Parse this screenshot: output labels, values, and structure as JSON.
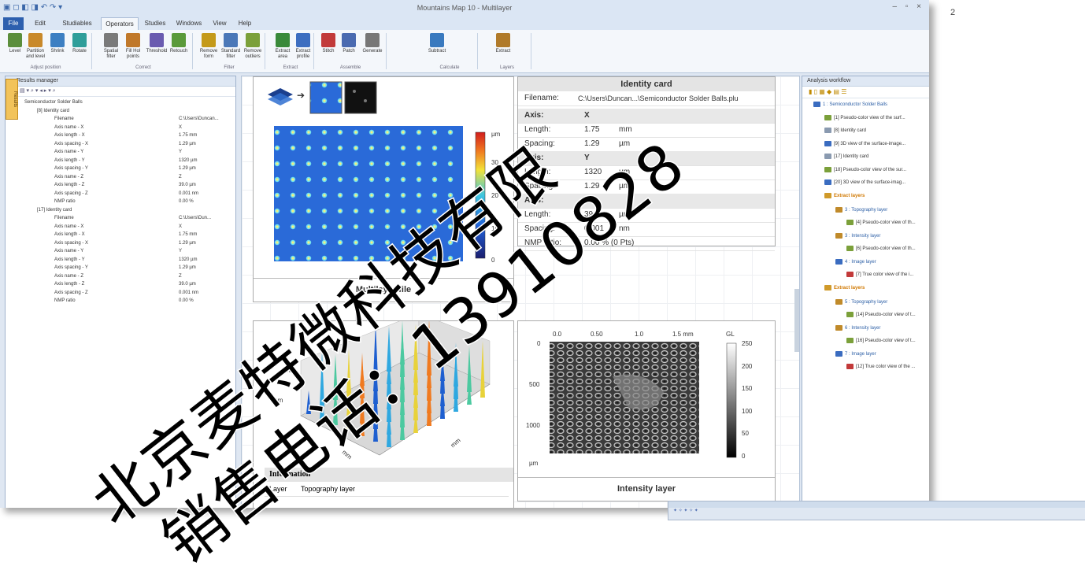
{
  "window": {
    "title": "Mountains Map 10 - Multilayer",
    "controls": "– ▫ ×",
    "tabs": [
      "File",
      "Edit",
      "Studiables",
      "Operators",
      "Studies",
      "Windows",
      "View",
      "Help"
    ],
    "active_tab": "Operators"
  },
  "ribbon": {
    "buttons": [
      {
        "label": "Level",
        "color": "#5b8e3c"
      },
      {
        "label": "Partition and level",
        "color": "#c9892a"
      },
      {
        "label": "Shrink",
        "color": "#3d7fc2"
      },
      {
        "label": "Rotate",
        "color": "#2f9e9a"
      },
      {
        "label": "Spatial filter",
        "color": "#7a7a7a"
      },
      {
        "label": "Fill Hol points",
        "color": "#c0782a"
      },
      {
        "label": "Threshold",
        "color": "#6a5bb0"
      },
      {
        "label": "Retouch",
        "color": "#5a9a3a"
      },
      {
        "label": "Remove form",
        "color": "#c49a1a"
      },
      {
        "label": "Standard filter",
        "color": "#4b78b8"
      },
      {
        "label": "Remove outliers",
        "color": "#7ba03a"
      },
      {
        "label": "Extract area",
        "color": "#3a8a3a"
      },
      {
        "label": "Extract profile",
        "color": "#3d6ec0"
      },
      {
        "label": "Stitch",
        "color": "#c23a3a"
      },
      {
        "label": "Patch",
        "color": "#4a6ab0"
      },
      {
        "label": "Generate",
        "color": "#777777"
      },
      {
        "label": "Subtract",
        "color": "#3a7abf"
      },
      {
        "label": "Extract",
        "color": "#b07a2a"
      }
    ],
    "groups": [
      "Adjust position",
      "Correct",
      "Filter",
      "Extract",
      "Assemble",
      "Calculate",
      "Layers"
    ]
  },
  "results_manager": {
    "title": "Results manager",
    "side_tab": "Results",
    "root": "Semiconductor Solder Balls",
    "cards": [
      {
        "label": "[8] Identity card",
        "rows": [
          {
            "k": "Filename",
            "v": "C:\\Users\\Duncan..."
          },
          {
            "k": "Axis name - X",
            "v": "X"
          },
          {
            "k": "Axis length - X",
            "v": "1.75 mm"
          },
          {
            "k": "Axis spacing - X",
            "v": "1.29 µm"
          },
          {
            "k": "Axis name - Y",
            "v": "Y"
          },
          {
            "k": "Axis length - Y",
            "v": "1320 µm"
          },
          {
            "k": "Axis spacing - Y",
            "v": "1.29 µm"
          },
          {
            "k": "Axis name - Z",
            "v": "Z"
          },
          {
            "k": "Axis length - Z",
            "v": "39.0 µm"
          },
          {
            "k": "Axis spacing - Z",
            "v": "0.001 nm"
          },
          {
            "k": "NMP ratio",
            "v": "0.00 %"
          }
        ]
      },
      {
        "label": "[17] Identity card",
        "rows": [
          {
            "k": "Filename",
            "v": "C:\\Users\\Dun..."
          },
          {
            "k": "Axis name - X",
            "v": "X"
          },
          {
            "k": "Axis length - X",
            "v": "1.75 mm"
          },
          {
            "k": "Axis spacing - X",
            "v": "1.29 µm"
          },
          {
            "k": "Axis name - Y",
            "v": "Y"
          },
          {
            "k": "Axis length - Y",
            "v": "1320 µm"
          },
          {
            "k": "Axis spacing - Y",
            "v": "1.29 µm"
          },
          {
            "k": "Axis name - Z",
            "v": "Z"
          },
          {
            "k": "Axis length - Z",
            "v": "39.0 µm"
          },
          {
            "k": "Axis spacing - Z",
            "v": "0.001 nm"
          },
          {
            "k": "NMP ratio",
            "v": "0.00 %"
          }
        ]
      }
    ]
  },
  "multilayer": {
    "caption": "Multilayer file",
    "unit": "µm",
    "scale_ticks": [
      "30",
      "20",
      "10",
      "0"
    ]
  },
  "identity_card": {
    "title": "Identity card",
    "filename_label": "Filename:",
    "filename_value": "C:\\Users\\Duncan...\\Semiconductor Solder Balls.plu",
    "rows": [
      {
        "c1": "Axis:",
        "c2": "X",
        "c3": "",
        "hdr": true
      },
      {
        "c1": "Length:",
        "c2": "1.75",
        "c3": "mm",
        "hdr": false
      },
      {
        "c1": "Spacing:",
        "c2": "1.29",
        "c3": "µm",
        "hdr": false
      },
      {
        "c1": "Axis:",
        "c2": "Y",
        "c3": "",
        "hdr": true
      },
      {
        "c1": "Length:",
        "c2": "1320",
        "c3": "µm",
        "hdr": false
      },
      {
        "c1": "Spacing:",
        "c2": "1.29",
        "c3": "µm",
        "hdr": false
      },
      {
        "c1": "Axis:",
        "c2": "Z",
        "c3": "",
        "hdr": true
      },
      {
        "c1": "Length:",
        "c2": "39.0",
        "c3": "µm",
        "hdr": false
      },
      {
        "c1": "Spacing:",
        "c2": "0.001",
        "c3": "nm",
        "hdr": false
      },
      {
        "c1": "NMP ratio:",
        "c2": "0.00 % (0 Pts)",
        "c3": "",
        "hdr": false
      }
    ]
  },
  "view3d": {
    "z_tick": "30",
    "z_unit": "µm",
    "x_unit": "mm",
    "y_unit": "mm",
    "info_title": "Information",
    "info_key": "Layer",
    "info_value": "Topography layer"
  },
  "intensity": {
    "caption": "Intensity layer",
    "x_ticks": [
      "0.0",
      "0.50",
      "1.0",
      "1.5 mm"
    ],
    "y_ticks": [
      "0",
      "500",
      "1000"
    ],
    "y_unit": "µm",
    "scale_title": "GL",
    "scale_ticks": [
      "250",
      "200",
      "150",
      "100",
      "50",
      "0"
    ]
  },
  "workflow": {
    "title": "Analysis workflow",
    "items": [
      {
        "text": "1 : Semiconductor Solder Balls",
        "style": "blue",
        "indent": 0,
        "icon": "#3a6cc0"
      },
      {
        "text": "[1] Pseudo-color view of the surf...",
        "style": "",
        "indent": 1,
        "icon": "#7ba03a"
      },
      {
        "text": "[8] Identity card",
        "style": "",
        "indent": 1,
        "icon": "#8a9ab0"
      },
      {
        "text": "[9] 3D view of the surface-image...",
        "style": "",
        "indent": 1,
        "icon": "#3a6cc0"
      },
      {
        "text": "[17] Identity card",
        "style": "",
        "indent": 1,
        "icon": "#8a9ab0"
      },
      {
        "text": "[18] Pseudo-color view of the sur...",
        "style": "",
        "indent": 1,
        "icon": "#7ba03a"
      },
      {
        "text": "[20] 3D view of the surface-imag...",
        "style": "",
        "indent": 1,
        "icon": "#3a6cc0"
      },
      {
        "text": "Extract layers",
        "style": "orange",
        "indent": 1,
        "icon": "#d09a2a"
      },
      {
        "text": "3 : Topography layer",
        "style": "blue",
        "indent": 2,
        "icon": "#c08a2a"
      },
      {
        "text": "[4] Pseudo-color view of th...",
        "style": "",
        "indent": 3,
        "icon": "#7ba03a"
      },
      {
        "text": "3 : Intensity layer",
        "style": "blue",
        "indent": 2,
        "icon": "#c08a2a"
      },
      {
        "text": "[6] Pseudo-color view of th...",
        "style": "",
        "indent": 3,
        "icon": "#7ba03a"
      },
      {
        "text": "4 : Image layer",
        "style": "blue",
        "indent": 2,
        "icon": "#3a6cc0"
      },
      {
        "text": "[7] True color view of the i...",
        "style": "",
        "indent": 3,
        "icon": "#c23a3a"
      },
      {
        "text": "Extract layers",
        "style": "orange",
        "indent": 1,
        "icon": "#d09a2a"
      },
      {
        "text": "5 : Topography layer",
        "style": "blue",
        "indent": 2,
        "icon": "#c08a2a"
      },
      {
        "text": "[14] Pseudo-color view of t...",
        "style": "",
        "indent": 3,
        "icon": "#7ba03a"
      },
      {
        "text": "6 : Intensity layer",
        "style": "blue",
        "indent": 2,
        "icon": "#c08a2a"
      },
      {
        "text": "[16] Pseudo-color view of t...",
        "style": "",
        "indent": 3,
        "icon": "#7ba03a"
      },
      {
        "text": "7 : Image layer",
        "style": "blue",
        "indent": 2,
        "icon": "#3a6cc0"
      },
      {
        "text": "[12] True color view of the ...",
        "style": "",
        "indent": 3,
        "icon": "#c23a3a"
      }
    ]
  },
  "page_number": "2",
  "watermark": {
    "line1": "北京麦特微科技有限",
    "line2": "销售电话：13910828",
    "color": "#000000"
  }
}
